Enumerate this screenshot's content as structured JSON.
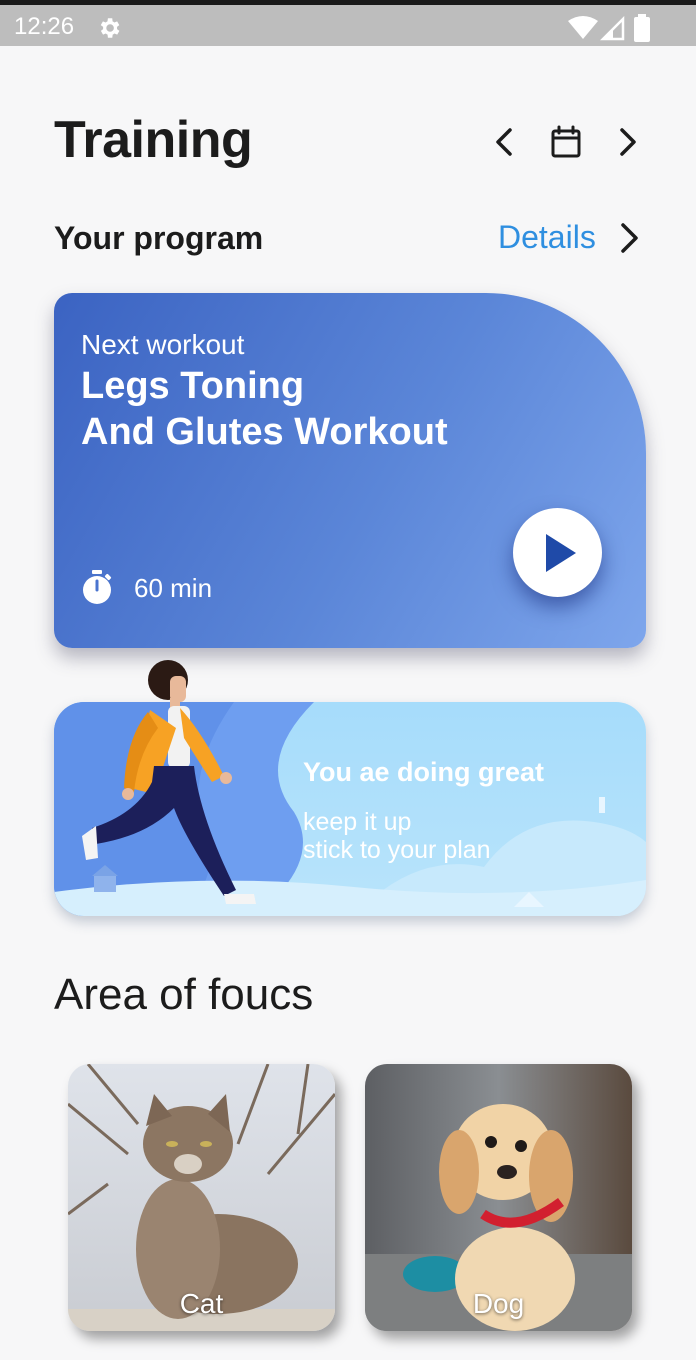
{
  "status_bar": {
    "time": "12:26",
    "icons": [
      "gear-icon",
      "wifi-icon",
      "signal-icon",
      "battery-icon"
    ]
  },
  "header": {
    "title": "Training",
    "icons": [
      "chevron-left-icon",
      "calendar-icon",
      "chevron-right-icon"
    ]
  },
  "program": {
    "section_title": "Your program",
    "details_label": "Details"
  },
  "workout": {
    "kicker": "Next workout",
    "title_line1": "Legs Toning",
    "title_line2": "And Glutes Workout",
    "duration": "60 min",
    "icon": "stopwatch-icon",
    "play_icon": "play-icon"
  },
  "motivation": {
    "title": "You ae doing great",
    "line1": "keep it up",
    "line2": "stick to your plan"
  },
  "focus": {
    "title": "Area of foucs",
    "items": [
      {
        "label": "Cat"
      },
      {
        "label": "Dog"
      }
    ]
  },
  "colors": {
    "accent_link": "#2f8fe0",
    "card_blue_dark": "#3b63c2",
    "card_blue_light": "#7ea6ec",
    "banner_sky": "#a6dcfb",
    "play_icon": "#1f4aa8"
  }
}
